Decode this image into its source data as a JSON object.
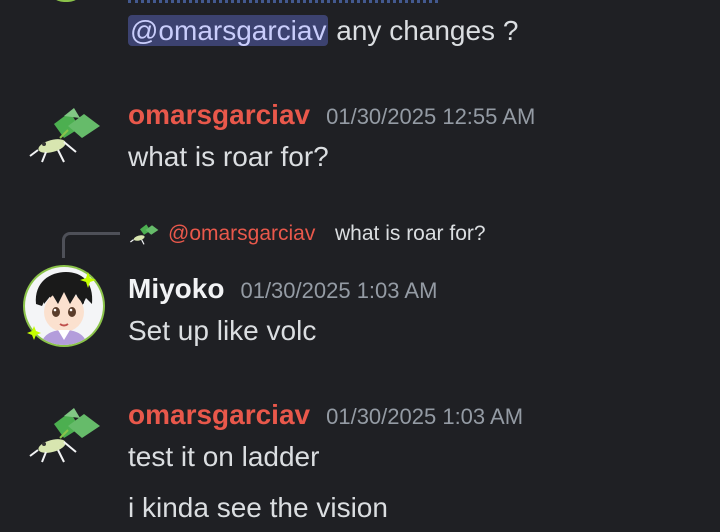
{
  "channel": {
    "messages": [
      {
        "continuation": true,
        "mention": "@omarsgarciav",
        "text": " any changes ?"
      },
      {
        "author": "omarsgarciav",
        "timestamp": "01/30/2025 12:55 AM",
        "avatar_icon": "plant-bug-avatar",
        "lines": [
          "what is roar for?"
        ]
      },
      {
        "author": "Miyoko",
        "timestamp": "01/30/2025 1:03 AM",
        "avatar_icon": "anime-character-avatar",
        "reply": {
          "author": "@omarsgarciav",
          "text": "what is roar for?"
        },
        "lines": [
          "Set up like volc"
        ]
      },
      {
        "author": "omarsgarciav",
        "timestamp": "01/30/2025 1:03 AM",
        "avatar_icon": "plant-bug-avatar",
        "lines": [
          "test it on ladder",
          "i kinda see the vision"
        ]
      }
    ]
  },
  "colors": {
    "background": "#1f2024",
    "author_omar": "#e9584b",
    "author_miyoko": "#f2f3f5",
    "timestamp": "#949ba4",
    "mention_bg": "#3c4270",
    "mention_text": "#c9cdfb"
  }
}
